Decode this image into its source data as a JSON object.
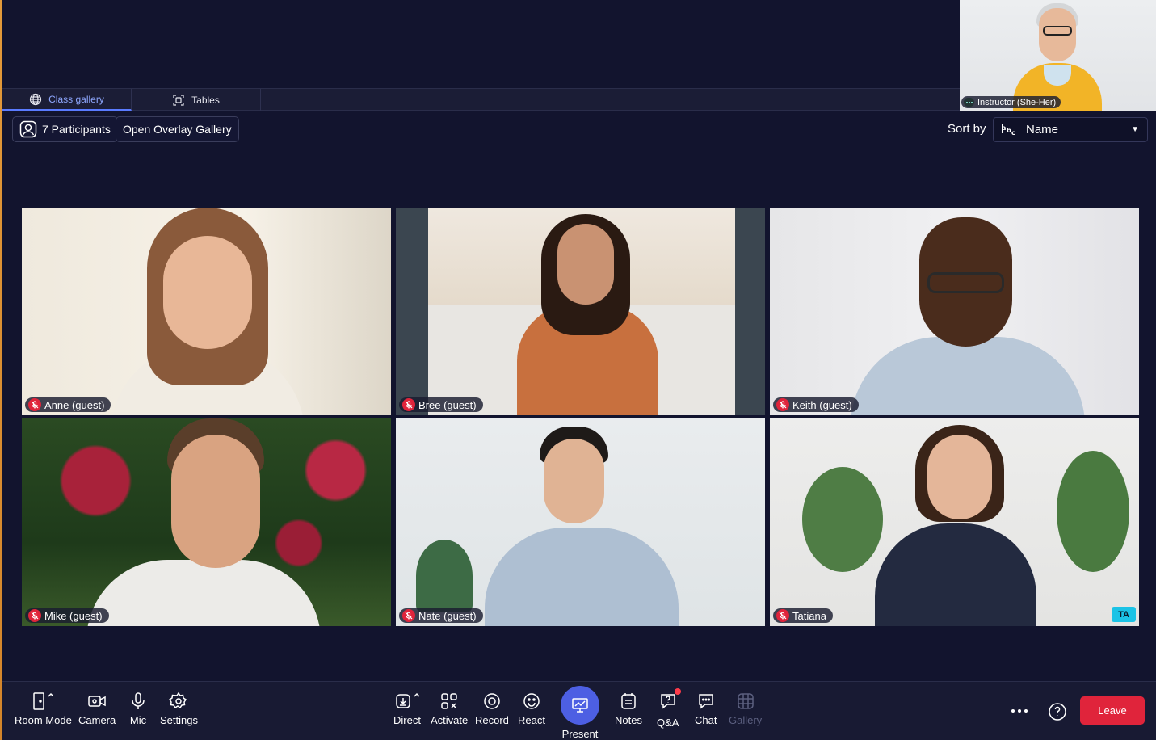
{
  "instructor": {
    "name": "Instructor (She-Her)"
  },
  "tabs": [
    {
      "label": "Class gallery",
      "icon": "globe-icon",
      "active": true
    },
    {
      "label": "Tables",
      "icon": "tables-icon",
      "active": false
    }
  ],
  "toolbar": {
    "participants_label": "7 Participants",
    "overlay_label": "Open Overlay Gallery",
    "sort_label": "Sort by",
    "sort_value": "Name"
  },
  "participants": [
    {
      "name": "Anne (guest)",
      "muted": true
    },
    {
      "name": "Bree (guest)",
      "muted": true
    },
    {
      "name": "Keith (guest)",
      "muted": true
    },
    {
      "name": "Mike (guest)",
      "muted": true
    },
    {
      "name": "Nate (guest)",
      "muted": true
    },
    {
      "name": "Tatiana",
      "muted": true,
      "badge": "TA"
    }
  ],
  "bottom_bar": {
    "room_mode": "Room Mode",
    "camera": "Camera",
    "mic": "Mic",
    "settings": "Settings",
    "direct": "Direct",
    "activate": "Activate",
    "record": "Record",
    "react": "React",
    "present": "Present",
    "notes": "Notes",
    "qa": "Q&A",
    "chat": "Chat",
    "gallery": "Gallery",
    "leave": "Leave"
  },
  "colors": {
    "background": "#12142e",
    "accent": "#4d5fe3",
    "danger": "#e0243b",
    "ta_badge": "#1bc3e6"
  }
}
